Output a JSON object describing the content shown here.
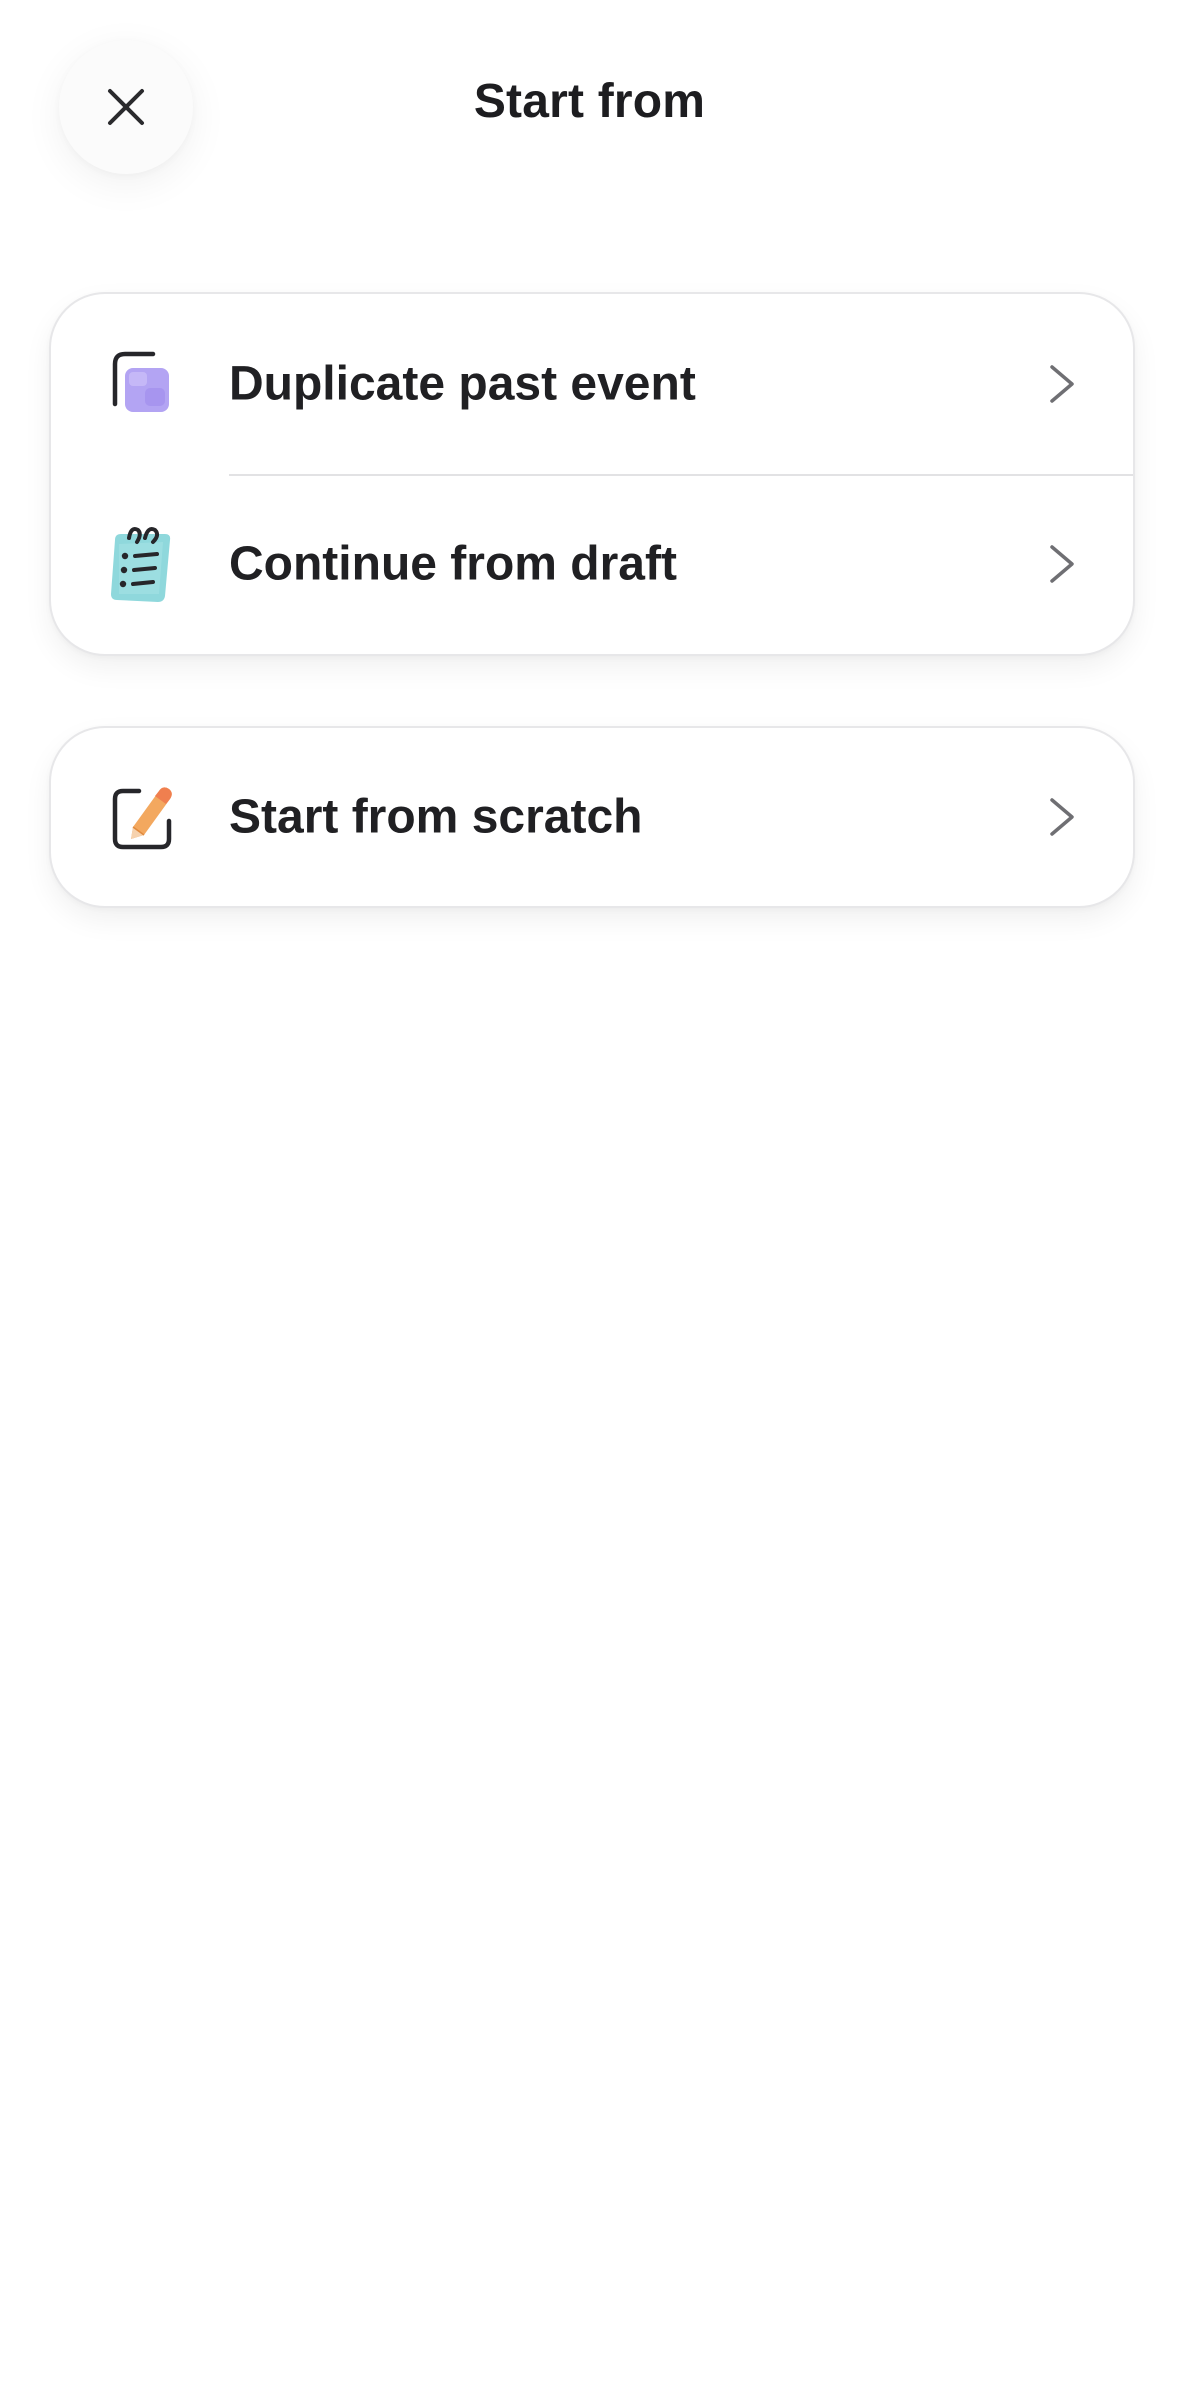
{
  "header": {
    "title": "Start from",
    "close_icon": "close-icon"
  },
  "options_group": {
    "items": [
      {
        "label": "Duplicate past event",
        "icon": "duplicate-icon"
      },
      {
        "label": "Continue from draft",
        "icon": "notepad-icon"
      }
    ]
  },
  "scratch_group": {
    "items": [
      {
        "label": "Start from scratch",
        "icon": "edit-pencil-icon"
      }
    ]
  },
  "colors": {
    "text": "#202023",
    "chevron": "#6f6f73",
    "duplicate_accent": "#b3a4f3",
    "notepad_accent": "#8fd8dc",
    "pencil_accent": "#f3a85f"
  }
}
